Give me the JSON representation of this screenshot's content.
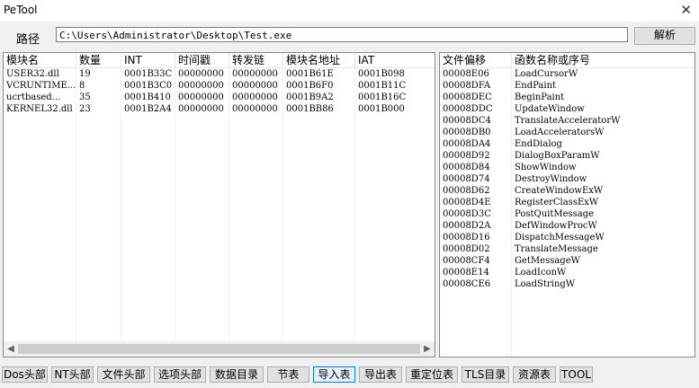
{
  "window": {
    "title": "PeTool",
    "close_glyph": "✕"
  },
  "path": {
    "label": "路径",
    "value": "C:\\Users\\Administrator\\Desktop\\Test.exe",
    "parse_button": "解析"
  },
  "import_table": {
    "headers": [
      "模块名",
      "数量",
      "INT",
      "时间戳",
      "转发链",
      "模块名地址",
      "IAT"
    ],
    "rows": [
      [
        "USER32.dll",
        "19",
        "0001B33C",
        "00000000",
        "00000000",
        "0001B61E",
        "0001B098"
      ],
      [
        "VCRUNTIME...",
        "8",
        "0001B3C0",
        "00000000",
        "00000000",
        "0001B6F0",
        "0001B11C"
      ],
      [
        "ucrtbased...",
        "35",
        "0001B410",
        "00000000",
        "00000000",
        "0001B9A2",
        "0001B16C"
      ],
      [
        "KERNEL32.dll",
        "23",
        "0001B2A4",
        "00000000",
        "00000000",
        "0001BB86",
        "0001B000"
      ]
    ]
  },
  "function_table": {
    "headers": [
      "文件偏移",
      "函数名称或序号"
    ],
    "rows": [
      [
        "00008E06",
        "LoadCursorW"
      ],
      [
        "00008DFA",
        "EndPaint"
      ],
      [
        "00008DEC",
        "BeginPaint"
      ],
      [
        "00008DDC",
        "UpdateWindow"
      ],
      [
        "00008DC4",
        "TranslateAcceleratorW"
      ],
      [
        "00008DB0",
        "LoadAcceleratorsW"
      ],
      [
        "00008DA4",
        "EndDialog"
      ],
      [
        "00008D92",
        "DialogBoxParamW"
      ],
      [
        "00008D84",
        "ShowWindow"
      ],
      [
        "00008D74",
        "DestroyWindow"
      ],
      [
        "00008D62",
        "CreateWindowExW"
      ],
      [
        "00008D4E",
        "RegisterClassExW"
      ],
      [
        "00008D3C",
        "PostQuitMessage"
      ],
      [
        "00008D2A",
        "DefWindowProcW"
      ],
      [
        "00008D16",
        "DispatchMessageW"
      ],
      [
        "00008D02",
        "TranslateMessage"
      ],
      [
        "00008CF4",
        "GetMessageW"
      ],
      [
        "00008E14",
        "LoadIconW"
      ],
      [
        "00008CE6",
        "LoadStringW"
      ]
    ]
  },
  "tabs": {
    "labels": [
      "Dos头部",
      "NT头部",
      "文件头部",
      "选项头部",
      "数据目录",
      "节表",
      "导入表",
      "导出表",
      "重定位表",
      "TLS目录",
      "资源表",
      "TOOL"
    ],
    "active": "导入表"
  }
}
